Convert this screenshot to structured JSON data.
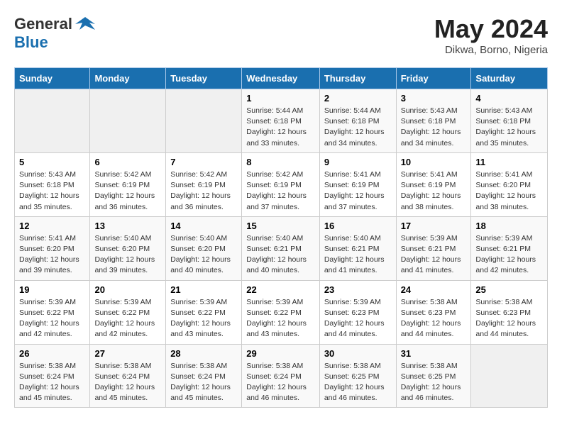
{
  "header": {
    "logo_general": "General",
    "logo_blue": "Blue",
    "month_year": "May 2024",
    "location": "Dikwa, Borno, Nigeria"
  },
  "days_of_week": [
    "Sunday",
    "Monday",
    "Tuesday",
    "Wednesday",
    "Thursday",
    "Friday",
    "Saturday"
  ],
  "weeks": [
    [
      {
        "num": "",
        "info": ""
      },
      {
        "num": "",
        "info": ""
      },
      {
        "num": "",
        "info": ""
      },
      {
        "num": "1",
        "info": "Sunrise: 5:44 AM\nSunset: 6:18 PM\nDaylight: 12 hours\nand 33 minutes."
      },
      {
        "num": "2",
        "info": "Sunrise: 5:44 AM\nSunset: 6:18 PM\nDaylight: 12 hours\nand 34 minutes."
      },
      {
        "num": "3",
        "info": "Sunrise: 5:43 AM\nSunset: 6:18 PM\nDaylight: 12 hours\nand 34 minutes."
      },
      {
        "num": "4",
        "info": "Sunrise: 5:43 AM\nSunset: 6:18 PM\nDaylight: 12 hours\nand 35 minutes."
      }
    ],
    [
      {
        "num": "5",
        "info": "Sunrise: 5:43 AM\nSunset: 6:18 PM\nDaylight: 12 hours\nand 35 minutes."
      },
      {
        "num": "6",
        "info": "Sunrise: 5:42 AM\nSunset: 6:19 PM\nDaylight: 12 hours\nand 36 minutes."
      },
      {
        "num": "7",
        "info": "Sunrise: 5:42 AM\nSunset: 6:19 PM\nDaylight: 12 hours\nand 36 minutes."
      },
      {
        "num": "8",
        "info": "Sunrise: 5:42 AM\nSunset: 6:19 PM\nDaylight: 12 hours\nand 37 minutes."
      },
      {
        "num": "9",
        "info": "Sunrise: 5:41 AM\nSunset: 6:19 PM\nDaylight: 12 hours\nand 37 minutes."
      },
      {
        "num": "10",
        "info": "Sunrise: 5:41 AM\nSunset: 6:19 PM\nDaylight: 12 hours\nand 38 minutes."
      },
      {
        "num": "11",
        "info": "Sunrise: 5:41 AM\nSunset: 6:20 PM\nDaylight: 12 hours\nand 38 minutes."
      }
    ],
    [
      {
        "num": "12",
        "info": "Sunrise: 5:41 AM\nSunset: 6:20 PM\nDaylight: 12 hours\nand 39 minutes."
      },
      {
        "num": "13",
        "info": "Sunrise: 5:40 AM\nSunset: 6:20 PM\nDaylight: 12 hours\nand 39 minutes."
      },
      {
        "num": "14",
        "info": "Sunrise: 5:40 AM\nSunset: 6:20 PM\nDaylight: 12 hours\nand 40 minutes."
      },
      {
        "num": "15",
        "info": "Sunrise: 5:40 AM\nSunset: 6:21 PM\nDaylight: 12 hours\nand 40 minutes."
      },
      {
        "num": "16",
        "info": "Sunrise: 5:40 AM\nSunset: 6:21 PM\nDaylight: 12 hours\nand 41 minutes."
      },
      {
        "num": "17",
        "info": "Sunrise: 5:39 AM\nSunset: 6:21 PM\nDaylight: 12 hours\nand 41 minutes."
      },
      {
        "num": "18",
        "info": "Sunrise: 5:39 AM\nSunset: 6:21 PM\nDaylight: 12 hours\nand 42 minutes."
      }
    ],
    [
      {
        "num": "19",
        "info": "Sunrise: 5:39 AM\nSunset: 6:22 PM\nDaylight: 12 hours\nand 42 minutes."
      },
      {
        "num": "20",
        "info": "Sunrise: 5:39 AM\nSunset: 6:22 PM\nDaylight: 12 hours\nand 42 minutes."
      },
      {
        "num": "21",
        "info": "Sunrise: 5:39 AM\nSunset: 6:22 PM\nDaylight: 12 hours\nand 43 minutes."
      },
      {
        "num": "22",
        "info": "Sunrise: 5:39 AM\nSunset: 6:22 PM\nDaylight: 12 hours\nand 43 minutes."
      },
      {
        "num": "23",
        "info": "Sunrise: 5:39 AM\nSunset: 6:23 PM\nDaylight: 12 hours\nand 44 minutes."
      },
      {
        "num": "24",
        "info": "Sunrise: 5:38 AM\nSunset: 6:23 PM\nDaylight: 12 hours\nand 44 minutes."
      },
      {
        "num": "25",
        "info": "Sunrise: 5:38 AM\nSunset: 6:23 PM\nDaylight: 12 hours\nand 44 minutes."
      }
    ],
    [
      {
        "num": "26",
        "info": "Sunrise: 5:38 AM\nSunset: 6:24 PM\nDaylight: 12 hours\nand 45 minutes."
      },
      {
        "num": "27",
        "info": "Sunrise: 5:38 AM\nSunset: 6:24 PM\nDaylight: 12 hours\nand 45 minutes."
      },
      {
        "num": "28",
        "info": "Sunrise: 5:38 AM\nSunset: 6:24 PM\nDaylight: 12 hours\nand 45 minutes."
      },
      {
        "num": "29",
        "info": "Sunrise: 5:38 AM\nSunset: 6:24 PM\nDaylight: 12 hours\nand 46 minutes."
      },
      {
        "num": "30",
        "info": "Sunrise: 5:38 AM\nSunset: 6:25 PM\nDaylight: 12 hours\nand 46 minutes."
      },
      {
        "num": "31",
        "info": "Sunrise: 5:38 AM\nSunset: 6:25 PM\nDaylight: 12 hours\nand 46 minutes."
      },
      {
        "num": "",
        "info": ""
      }
    ]
  ]
}
